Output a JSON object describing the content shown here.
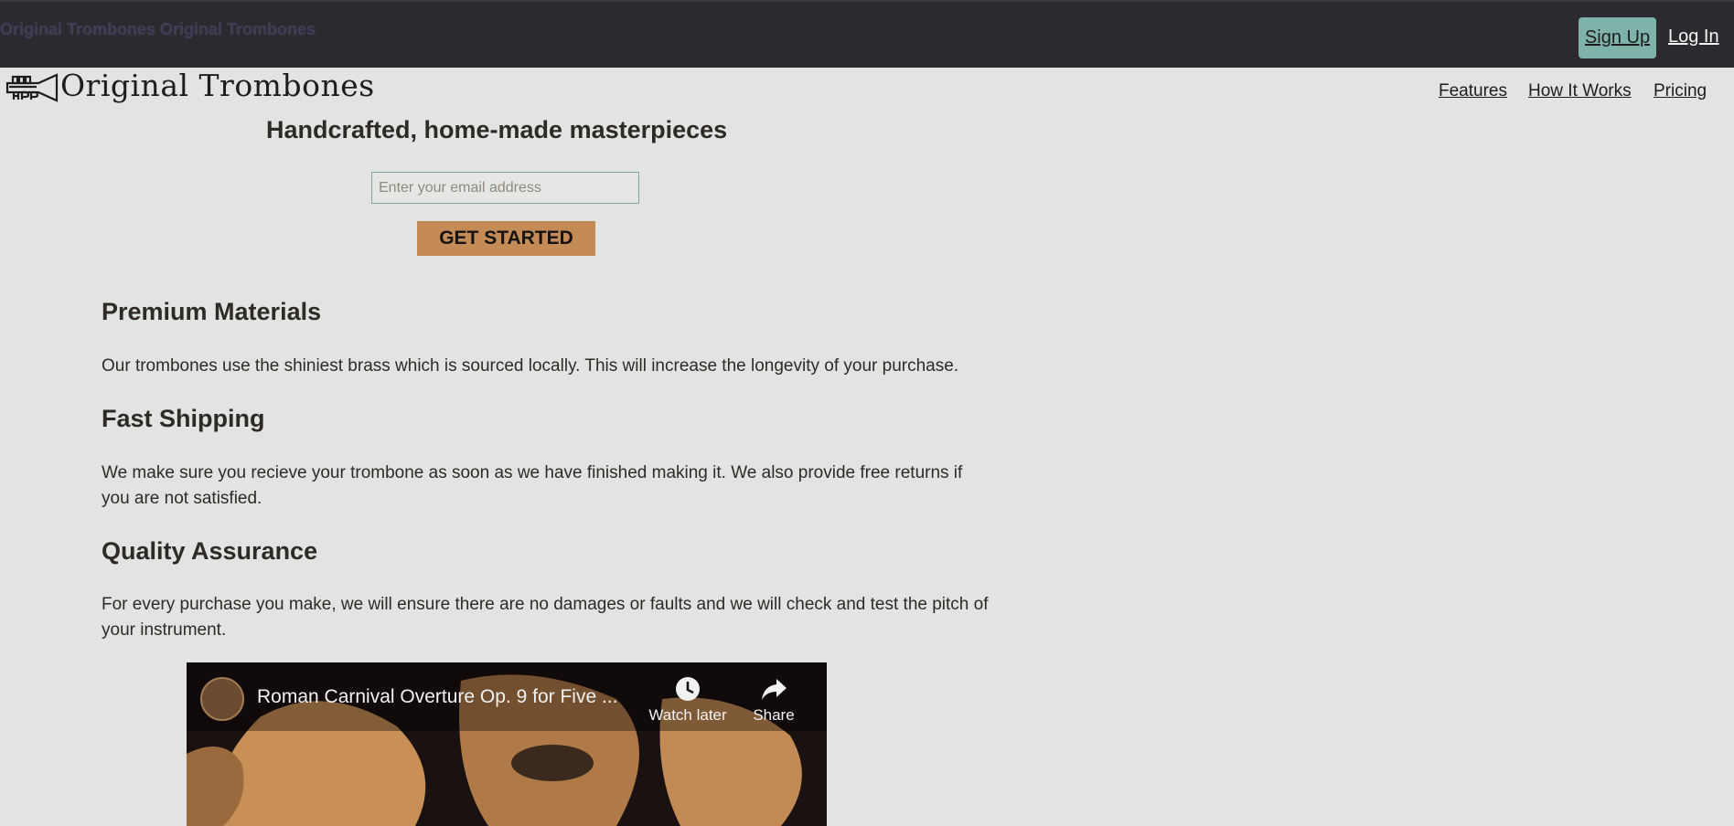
{
  "topbar": {
    "brand_text": "Original Trombones Original Trombones",
    "signup_label": "Sign Up",
    "login_label": "Log In"
  },
  "header": {
    "logo_text": "Original Trombones",
    "nav": [
      "Features",
      "How It Works",
      "Pricing"
    ]
  },
  "hero": {
    "title": "Handcrafted, home-made masterpieces",
    "email_placeholder": "Enter your email address",
    "email_value": "",
    "cta_label": "GET STARTED"
  },
  "features": [
    {
      "title": "Premium Materials",
      "text": "Our trombones use the shiniest brass which is sourced locally. This will increase the longevity of your purchase."
    },
    {
      "title": "Fast Shipping",
      "text": "We make sure you recieve your trombone as soon as we have finished making it. We also provide free returns if you are not satisfied."
    },
    {
      "title": "Quality Assurance",
      "text": "For every purchase you make, we will ensure there are no damages or faults and we will check and test the pitch of your instrument."
    }
  ],
  "video": {
    "title": "Roman Carnival Overture Op. 9 for Five ...",
    "watch_later_label": "Watch later",
    "share_label": "Share"
  },
  "colors": {
    "topbar_bg": "#2c2a2f",
    "page_bg": "#e3e3e1",
    "signup_bg": "#7fb2a9",
    "cta_bg": "#c58b57"
  }
}
